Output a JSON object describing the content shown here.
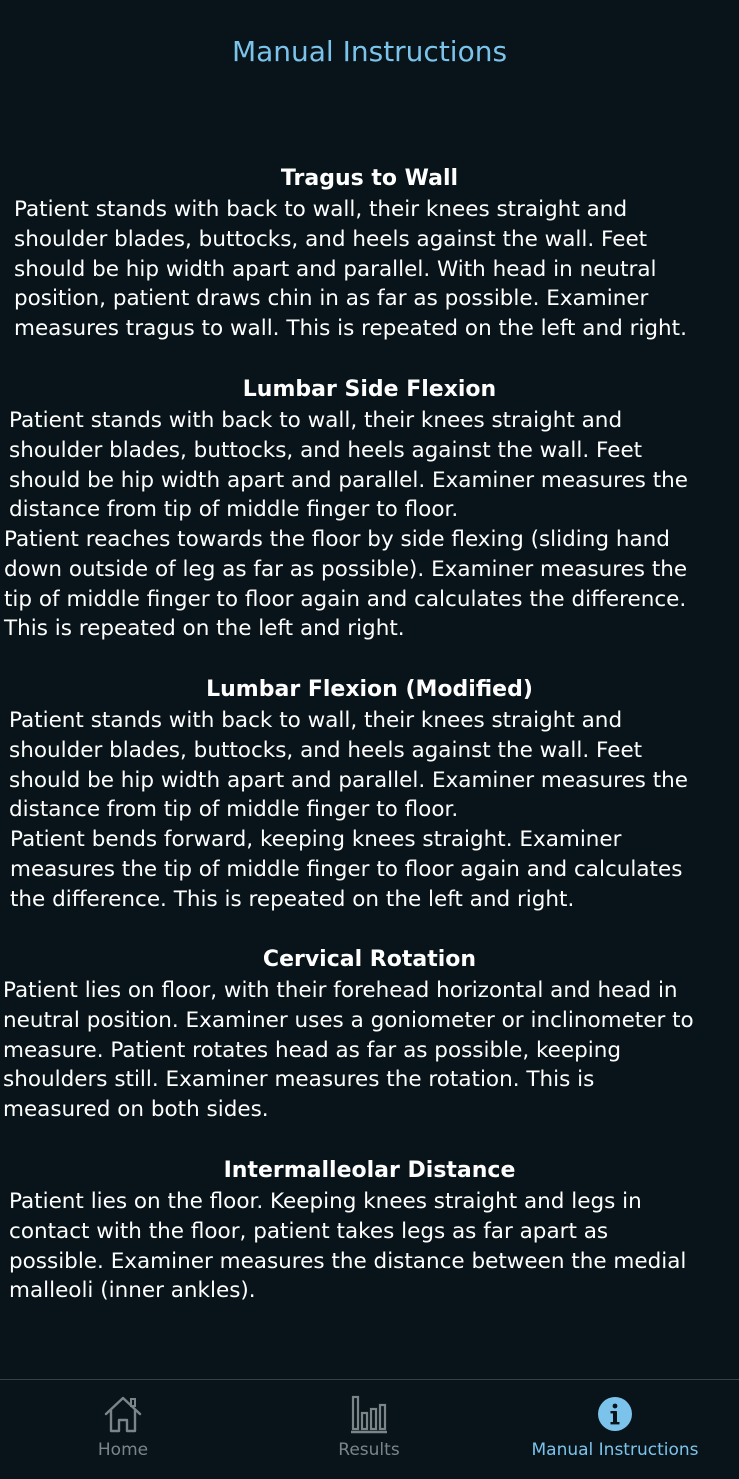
{
  "header": {
    "title": "Manual Instructions"
  },
  "sections": [
    {
      "title": "Tragus to Wall",
      "paragraphs": [
        [
          "Patient stands with back to wall, their knees straight and",
          "shoulder blades, buttocks, and heels against the wall. Feet",
          "should be hip width apart and parallel. With head in neutral",
          "position, patient draws chin in as far as possible. Examiner",
          "measures tragus to wall. This is repeated on the left and right."
        ]
      ]
    },
    {
      "title": "Lumbar Side Flexion",
      "paragraphs": [
        [
          "Patient stands with back to wall, their knees straight and",
          "shoulder blades, buttocks, and heels against the wall. Feet",
          "should be hip width apart and parallel. Examiner measures the",
          "distance from tip of middle finger to floor."
        ],
        [
          "Patient reaches towards the floor by side flexing (sliding hand",
          "down outside of leg as far as possible). Examiner measures the",
          "tip of middle finger to floor again and calculates the difference.",
          "This is repeated on the left and right."
        ]
      ]
    },
    {
      "title": "Lumbar Flexion (Modified)",
      "paragraphs": [
        [
          "Patient stands with back to wall, their knees straight and",
          "shoulder blades, buttocks, and heels against the wall. Feet",
          "should be hip width apart and parallel. Examiner measures the",
          "distance from tip of middle finger to floor."
        ],
        [
          "Patient bends forward, keeping knees straight. Examiner",
          "measures the tip of middle finger to floor again and calculates",
          "the difference. This is repeated on the left and right."
        ]
      ]
    },
    {
      "title": "Cervical Rotation",
      "paragraphs": [
        [
          "Patient lies on floor, with their forehead horizontal and head in",
          "neutral position. Examiner uses a goniometer or inclinometer to",
          "measure. Patient rotates head as far as possible, keeping",
          "shoulders still. Examiner measures the rotation. This is",
          "measured on both sides."
        ]
      ]
    },
    {
      "title": "Intermalleolar Distance",
      "paragraphs": [
        [
          "Patient lies on the floor. Keeping knees straight and legs in",
          "contact with the floor, patient takes legs as far apart as",
          "possible. Examiner measures the distance between the medial",
          "malleoli (inner ankles)."
        ]
      ]
    }
  ],
  "tabbar": {
    "tabs": [
      {
        "label": "Home",
        "icon": "home-icon",
        "active": false
      },
      {
        "label": "Results",
        "icon": "bar-chart-icon",
        "active": false
      },
      {
        "label": "Manual Instructions",
        "icon": "info-icon",
        "active": true
      }
    ]
  },
  "colors": {
    "background": "#08141a",
    "accent": "#7cc3ec",
    "inactive": "#7b8589",
    "text": "#ffffff"
  }
}
